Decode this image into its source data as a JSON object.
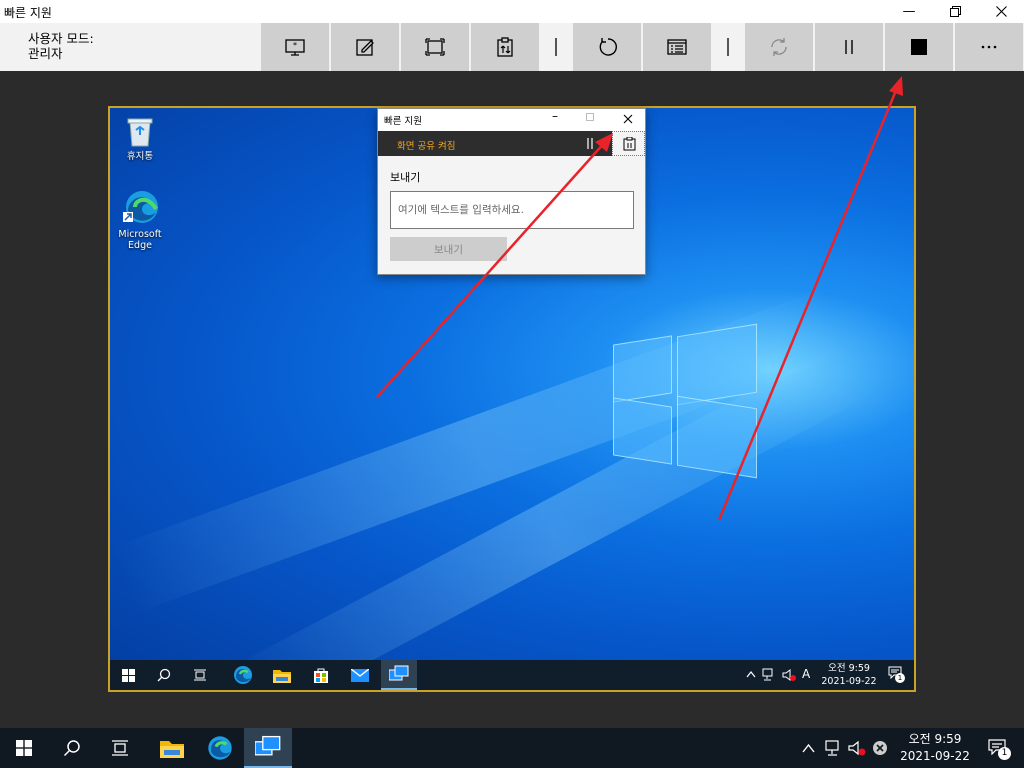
{
  "window": {
    "title": "빠른 지원",
    "minimize_icon": "minimize-icon",
    "restore_icon": "restore-icon",
    "close_icon": "close-icon"
  },
  "toolbar": {
    "mode_line1": "사용자 모드:",
    "mode_line2": "관리자",
    "buttons": [
      {
        "name": "select-monitor-icon"
      },
      {
        "name": "annotate-icon"
      },
      {
        "name": "actual-size-icon"
      },
      {
        "name": "instruction-channel-icon"
      },
      {
        "name": "separator"
      },
      {
        "name": "restart-icon"
      },
      {
        "name": "task-manager-icon"
      },
      {
        "name": "separator"
      },
      {
        "name": "reconnect-icon",
        "disabled": true
      },
      {
        "name": "pause-icon"
      },
      {
        "name": "end-icon"
      },
      {
        "name": "more-icon"
      }
    ]
  },
  "remote": {
    "desktop_icons": [
      {
        "label": "휴지통",
        "icon": "recycle-bin-icon"
      },
      {
        "label": "Microsoft Edge",
        "icon": "edge-icon"
      }
    ],
    "dialog": {
      "title": "빠른 지원",
      "status": "화면 공유 켜짐",
      "send_label": "보내기",
      "input_placeholder": "여기에 텍스트를 입력하세요.",
      "send_button": "보내기"
    },
    "taskbar": {
      "time": "오전 9:59",
      "date": "2021-09-22",
      "ime": "A",
      "notification_count": "1"
    }
  },
  "taskbar": {
    "time": "오전 9:59",
    "date": "2021-09-22",
    "notification_count": "1"
  },
  "colors": {
    "remote_border": "#c9a227",
    "arrow": "#e8232a",
    "status_text": "#f5a623",
    "desktop_blue": "#0b6fe0"
  }
}
